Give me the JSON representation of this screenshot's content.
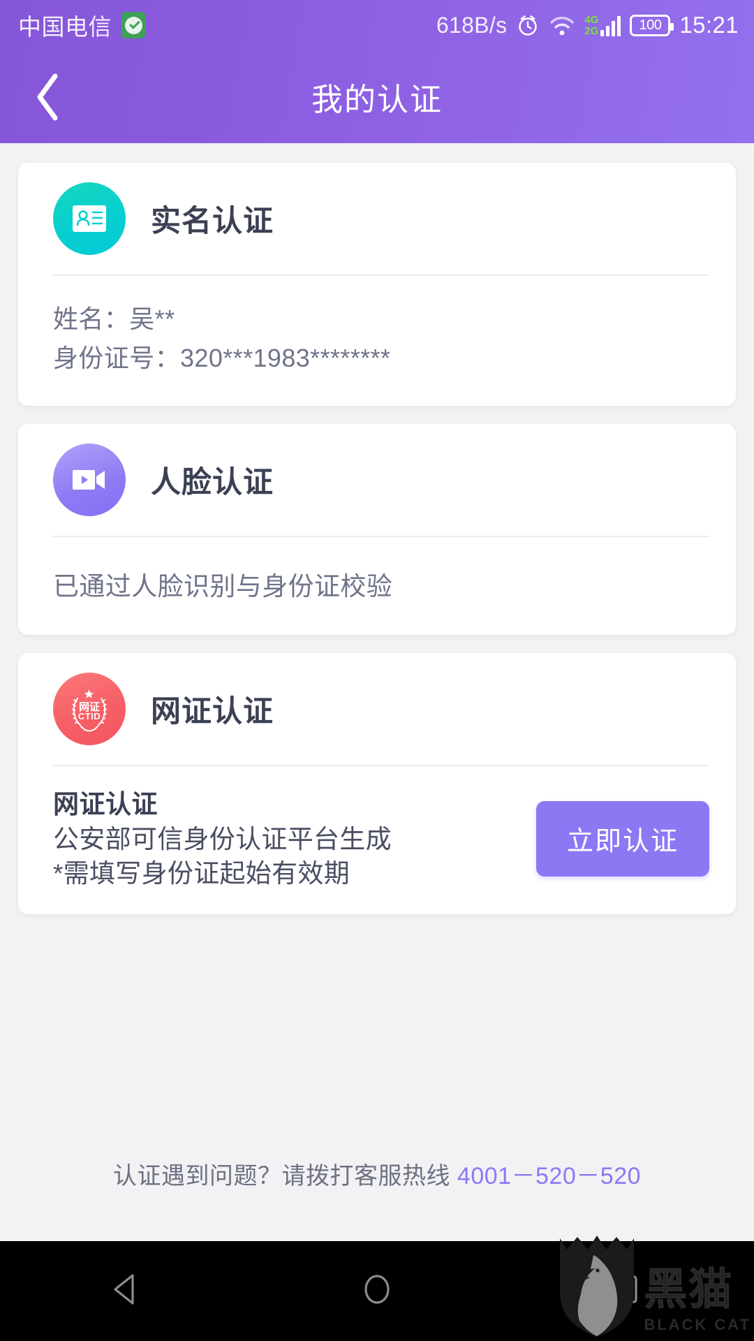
{
  "statusbar": {
    "carrier": "中国电信",
    "wechat_badge_icon": "wechat-check-icon",
    "net_speed": "618B/s",
    "alarm_icon": "alarm-clock-icon",
    "wifi_icon": "wifi-icon",
    "signal_tag_top": "4G",
    "signal_tag_bottom": "2G",
    "signal_icon": "cellular-signal-icon",
    "battery_level": "100",
    "time": "15:21"
  },
  "titlebar": {
    "back_icon": "chevron-left-icon",
    "title": "我的认证"
  },
  "cards": [
    {
      "icon": "id-card-icon",
      "icon_color": "#07cfd0",
      "title": "实名认证",
      "lines": [
        "姓名：吴**",
        "身份证号：320***1983********"
      ]
    },
    {
      "icon": "video-camera-icon",
      "icon_color": "#8f79f4",
      "title": "人脸认证",
      "status": "已通过人脸识别与身份证校验"
    },
    {
      "icon": "ctid-seal-icon",
      "icon_color": "#f45661",
      "icon_text_cn": "网证",
      "icon_text_en": "CTID",
      "title": "网证认证",
      "body_title": "网证认证",
      "body_line2": "公安部可信身份认证平台生成",
      "body_line3": "*需填写身份证起始有效期",
      "button_label": "立即认证",
      "button_color": "#8b79f4"
    }
  ],
  "footer": {
    "help_text": "认证遇到问题？请拨打客服热线 ",
    "hotline": "4001－520－520",
    "hotline_color": "#8b79f4"
  },
  "navbar": {
    "back_icon": "triangle-back-icon",
    "home_icon": "circle-home-icon",
    "recents_icon": "square-recents-icon"
  },
  "watermark": {
    "shield_icon": "black-cat-shield-icon",
    "cn": "黑猫",
    "en": "BLACK CAT"
  }
}
